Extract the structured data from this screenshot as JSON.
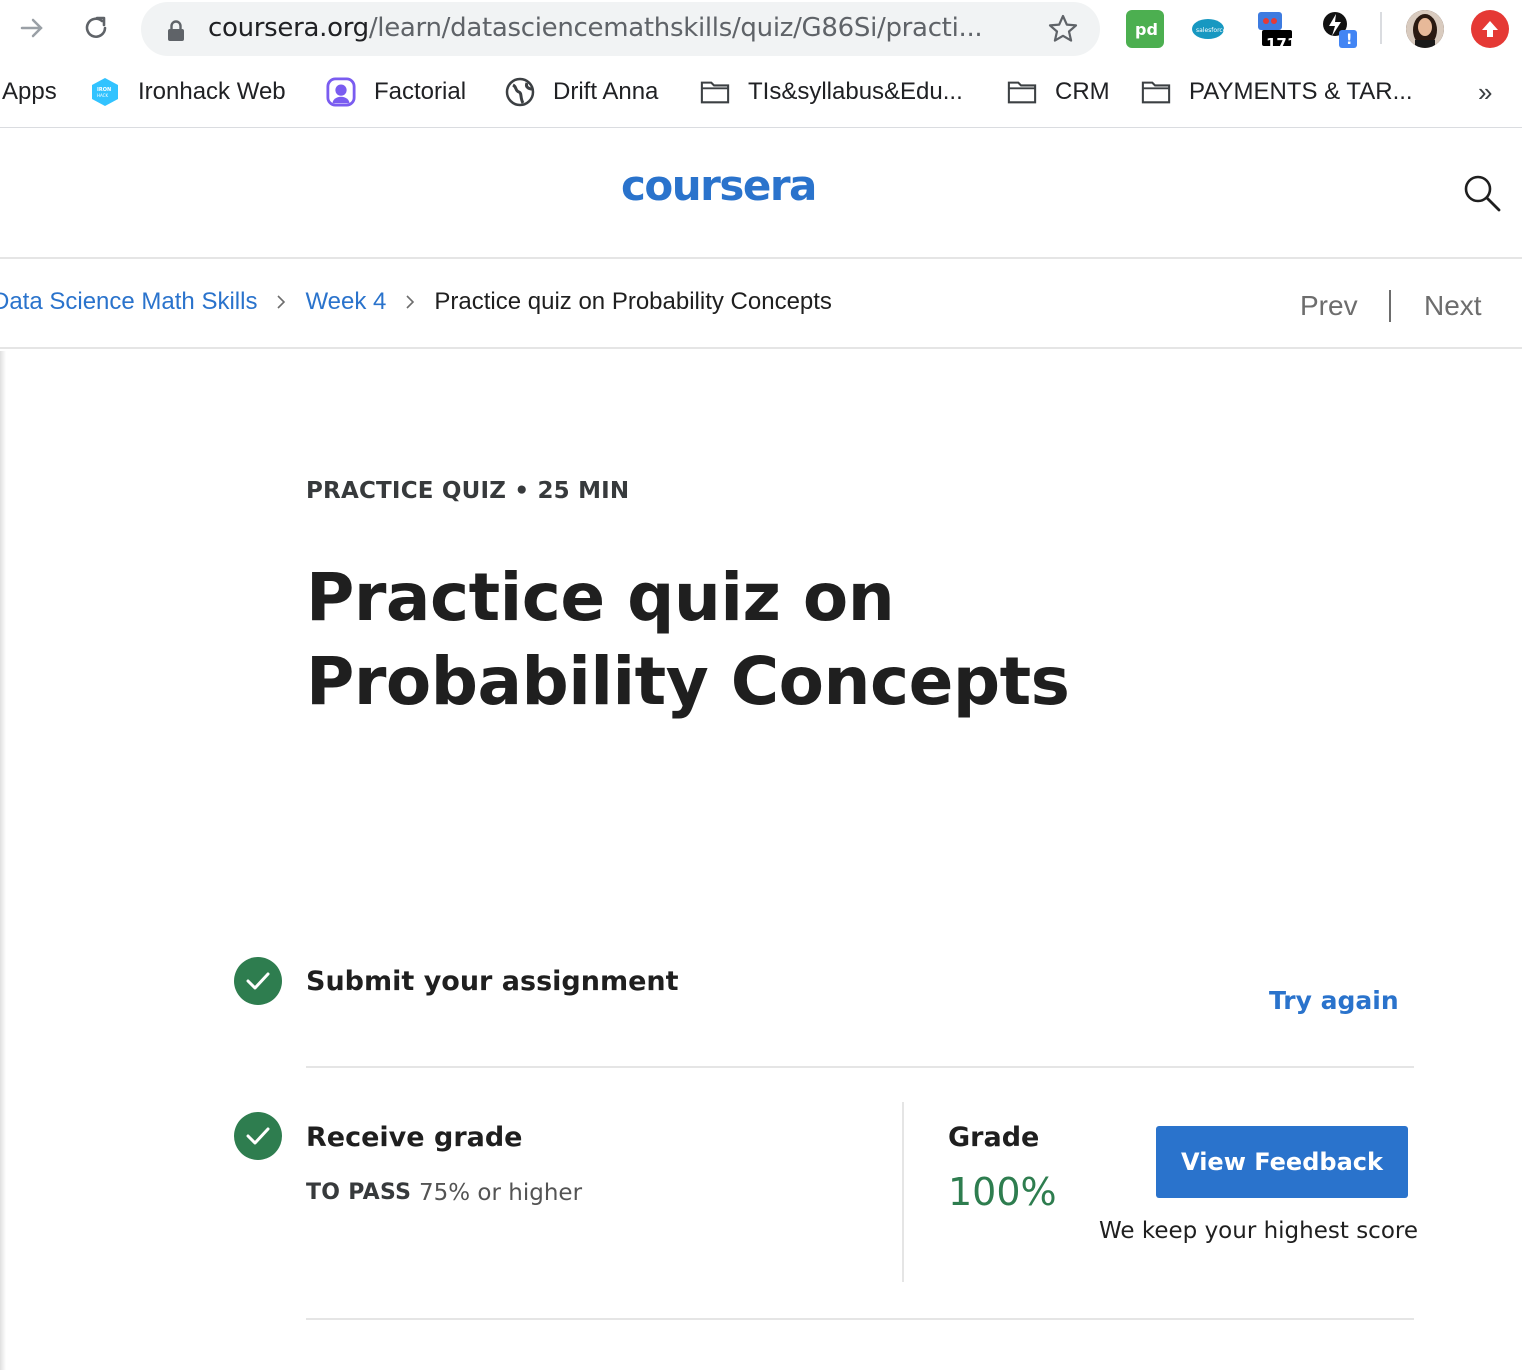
{
  "browser": {
    "url_host": "coursera.org",
    "url_path": "/learn/datasciencemathskills/quiz/G86Si/practi...",
    "extensions": [
      {
        "name": "pandadoc-extension",
        "badge": ""
      },
      {
        "name": "salesforce-extension",
        "badge": ""
      },
      {
        "name": "tabs-counter-extension",
        "badge": "171"
      },
      {
        "name": "lightning-extension",
        "badge": "!"
      }
    ]
  },
  "bookmarks": {
    "items": [
      {
        "label": "Apps",
        "icon": "apps-grid-icon"
      },
      {
        "label": "Ironhack Web",
        "icon": "ironhack-icon"
      },
      {
        "label": "Factorial",
        "icon": "factorial-icon"
      },
      {
        "label": "Drift Anna",
        "icon": "globe-icon"
      },
      {
        "label": "TIs&syllabus&Edu...",
        "icon": "folder-icon"
      },
      {
        "label": "CRM",
        "icon": "folder-icon"
      },
      {
        "label": "PAYMENTS & TAR...",
        "icon": "folder-icon"
      }
    ],
    "overflow": "»"
  },
  "site": {
    "logo": "coursera"
  },
  "breadcrumb": {
    "course": "Data Science Math Skills",
    "week": "Week 4",
    "current": "Practice quiz on Probability Concepts"
  },
  "nav": {
    "prev": "Prev",
    "next": "Next"
  },
  "quiz": {
    "kicker": "PRACTICE QUIZ • 25 MIN",
    "title": "Practice quiz on Probability Concepts",
    "steps": {
      "submit": {
        "title": "Submit your assignment",
        "action": "Try again"
      },
      "grade": {
        "title": "Receive grade",
        "pass_label": "TO PASS",
        "pass_value": "75% or higher",
        "grade_label": "Grade",
        "grade_value": "100%",
        "feedback_button": "View Feedback",
        "note": "We keep your highest score"
      }
    }
  },
  "colors": {
    "brand_blue": "#2a73cc",
    "success_green": "#2e7d4f"
  }
}
